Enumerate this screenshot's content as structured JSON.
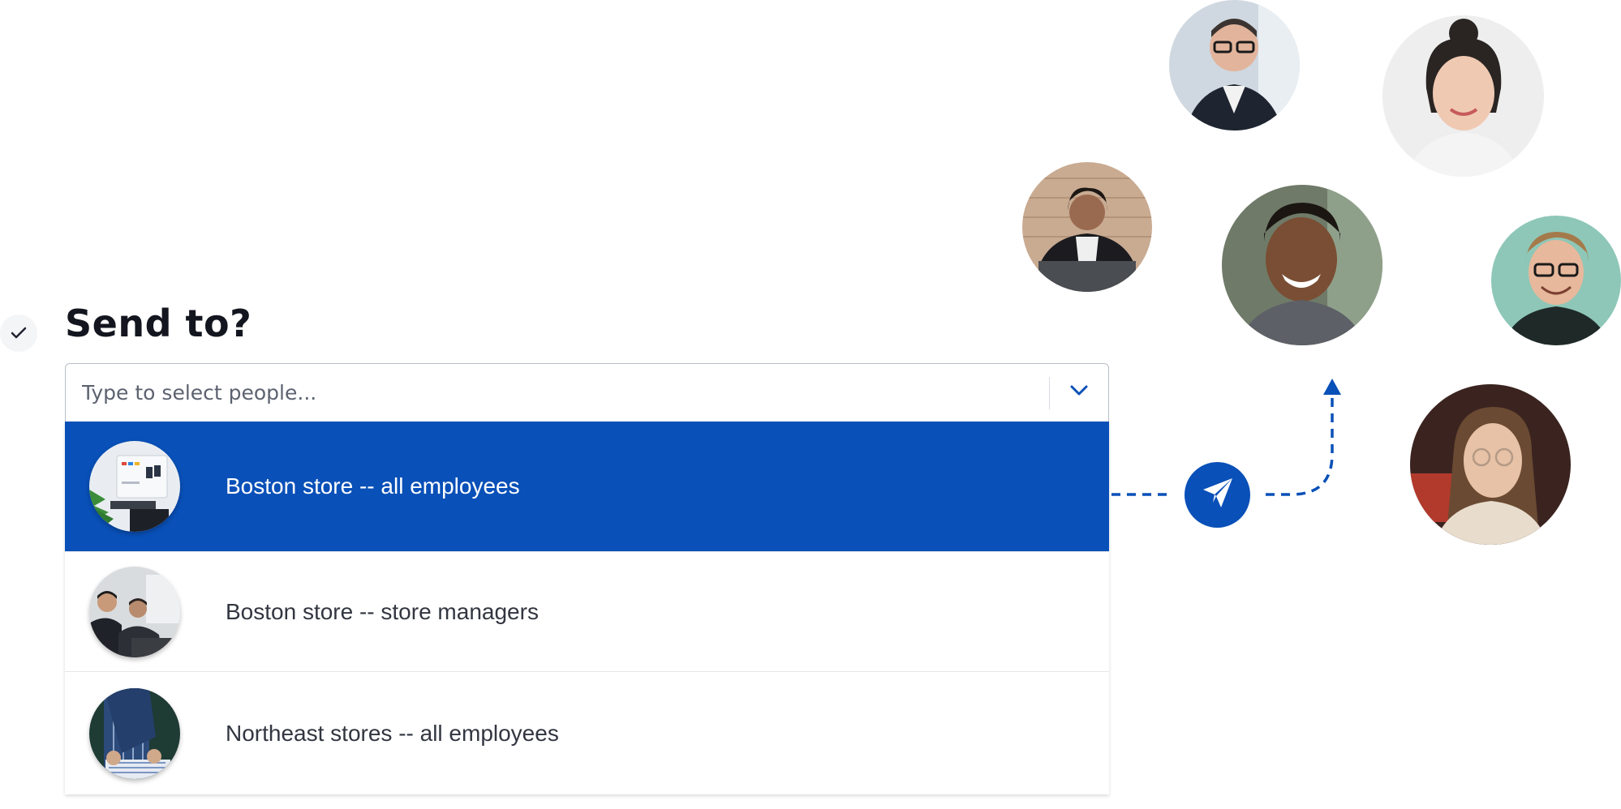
{
  "heading": "Send to?",
  "search": {
    "placeholder": "Type to select people..."
  },
  "options": [
    {
      "label": "Boston store -- all employees",
      "selected": true
    },
    {
      "label": "Boston store -- store managers",
      "selected": false
    },
    {
      "label": "Northeast stores -- all employees",
      "selected": false
    }
  ],
  "icons": {
    "status": "checkmark-icon",
    "dropdown": "chevron-down-icon",
    "send": "paper-plane-icon"
  },
  "colors": {
    "accent": "#0950b8",
    "title": "#13161f",
    "option_text": "#323640"
  }
}
